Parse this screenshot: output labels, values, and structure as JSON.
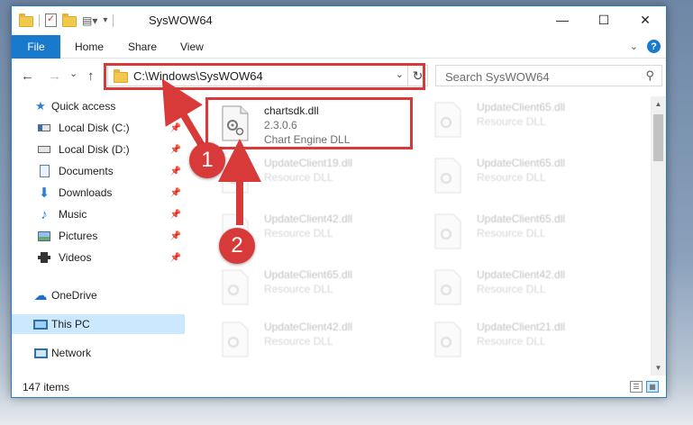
{
  "window": {
    "title": "SysWOW64",
    "controls": {
      "minimize": "—",
      "maximize": "☐",
      "close": "✕"
    }
  },
  "ribbon": {
    "tabs": [
      "File",
      "Home",
      "Share",
      "View"
    ],
    "expand_icon": "chevron-down-icon",
    "help_label": "?"
  },
  "address_bar": {
    "path": "C:\\Windows\\SysWOW64",
    "dropdown": "⌄",
    "refresh": "↻"
  },
  "search": {
    "placeholder": "Search SysWOW64",
    "icon": "search-icon"
  },
  "nav": {
    "back": "←",
    "forward": "→",
    "recent": "⌄",
    "up": "↑"
  },
  "sidebar": {
    "quick_access": "Quick access",
    "items": [
      {
        "label": "Local Disk (C:)",
        "icon": "drive-icon",
        "pinned": true
      },
      {
        "label": "Local Disk (D:)",
        "icon": "drive-icon",
        "pinned": true
      },
      {
        "label": "Documents",
        "icon": "documents-icon",
        "pinned": true
      },
      {
        "label": "Downloads",
        "icon": "downloads-icon",
        "pinned": true
      },
      {
        "label": "Music",
        "icon": "music-icon",
        "pinned": true
      },
      {
        "label": "Pictures",
        "icon": "pictures-icon",
        "pinned": true
      },
      {
        "label": "Videos",
        "icon": "videos-icon",
        "pinned": true
      }
    ],
    "onedrive": "OneDrive",
    "this_pc": "This PC",
    "network": "Network"
  },
  "files": {
    "main": {
      "name": "chartsdk.dll",
      "version": "2.3.0.6",
      "description": "Chart Engine DLL"
    },
    "background": [
      {
        "name": "UpdateClient65.dll",
        "description": "Resource DLL"
      },
      {
        "name": "UpdateClient19.dll",
        "description": "Resource DLL"
      },
      {
        "name": "UpdateClient65.dll",
        "description": "Resource DLL"
      },
      {
        "name": "UpdateClient42.dll",
        "description": "Resource DLL"
      },
      {
        "name": "UpdateClient65.dll",
        "description": "Resource DLL"
      },
      {
        "name": "UpdateClient65.dll",
        "description": "Resource DLL"
      },
      {
        "name": "UpdateClient42.dll",
        "description": "Resource DLL"
      },
      {
        "name": "UpdateClient42.dll",
        "description": "Resource DLL"
      },
      {
        "name": "UpdateClient21.dll",
        "description": "Resource DLL"
      }
    ]
  },
  "status": {
    "item_count": "147 items"
  },
  "annotations": {
    "step1": "1",
    "step2": "2",
    "color": "#d83a3a"
  },
  "colors": {
    "accent": "#1979ca",
    "selection": "#cce8ff",
    "highlight": "#d83a3a"
  }
}
